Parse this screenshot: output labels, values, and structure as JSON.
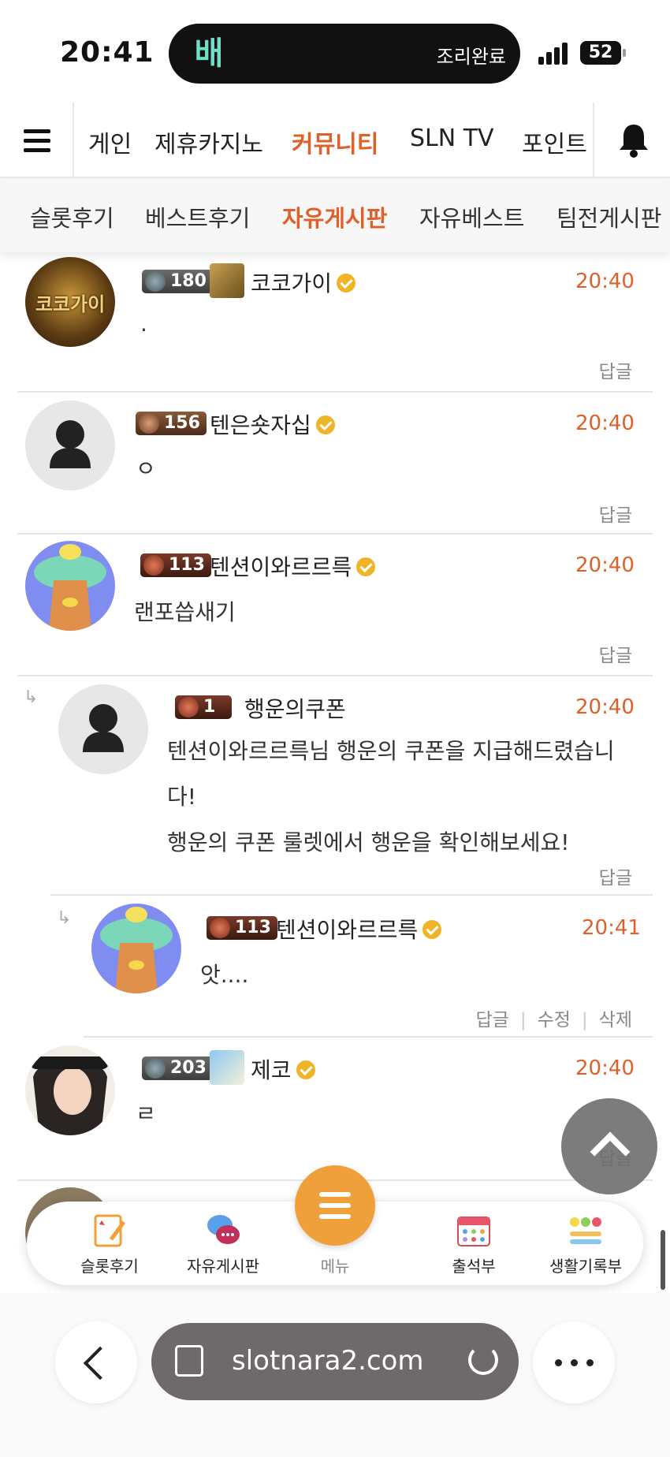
{
  "status_bar": {
    "time": "20:41",
    "island_logo": "배",
    "island_text": "조리완료",
    "battery": "52"
  },
  "top_nav": {
    "items": [
      "게인",
      "제휴카지노",
      "커뮤니티",
      "SLN TV",
      "포인트"
    ],
    "active": "커뮤니티"
  },
  "sub_nav": {
    "items": [
      "슬롯후기",
      "베스트후기",
      "자유게시판",
      "자유베스트",
      "팀전게시판"
    ],
    "active": "자유게시판"
  },
  "comments": [
    {
      "level": "180",
      "username": "코코가이",
      "verified": true,
      "time": "20:40",
      "text": ".",
      "actions": [
        "답글"
      ],
      "avatar_text": "코코가이"
    },
    {
      "level": "156",
      "username": "텐은숏자십",
      "verified": true,
      "time": "20:40",
      "text": "ㅇ",
      "actions": [
        "답글"
      ]
    },
    {
      "level": "113",
      "username": "텐션이와르르륵",
      "verified": true,
      "time": "20:40",
      "text": "랜포씁새기",
      "actions": [
        "답글"
      ]
    },
    {
      "level": "1",
      "username": "행운의쿠폰",
      "verified": false,
      "time": "20:40",
      "text_lines": [
        "텐션이와르르륵님 행운의 쿠폰을 지급해드렸습니",
        "다!",
        "행운의 쿠폰 룰렛에서 행운을 확인해보세요!"
      ],
      "actions": [
        "답글"
      ]
    },
    {
      "level": "113",
      "username": "텐션이와르르륵",
      "verified": true,
      "time": "20:41",
      "text": "앗....",
      "actions": [
        "답글",
        "수정",
        "삭제"
      ]
    },
    {
      "level": "203",
      "username": "제코",
      "verified": true,
      "time": "20:40",
      "text": "ㄹ",
      "actions": [
        "답글"
      ]
    }
  ],
  "tab_bar": {
    "items": [
      "슬롯후기",
      "자유게시판",
      "출석부",
      "생활기록부"
    ],
    "menu_label": "메뉴"
  },
  "browser": {
    "url": "slotnara2.com"
  },
  "colors": {
    "accent": "#e0602a",
    "menu_button": "#f0a03a",
    "verified": "#f0b429"
  }
}
